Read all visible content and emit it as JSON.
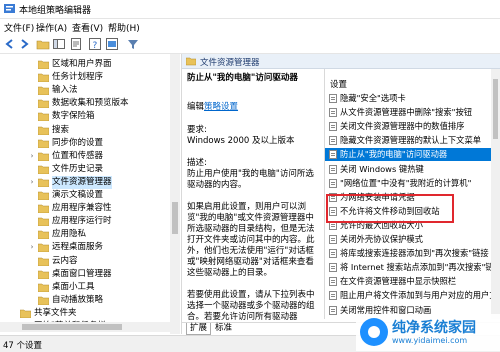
{
  "window": {
    "title": "本地组策略编辑器"
  },
  "menu": [
    "文件(F)",
    "操作(A)",
    "查看(V)",
    "帮助(H)"
  ],
  "tree": {
    "items": [
      {
        "label": "区域和用户界面",
        "indent": 1,
        "arrow": ""
      },
      {
        "label": "任务计划程序",
        "indent": 1,
        "arrow": ""
      },
      {
        "label": "输入法",
        "indent": 1,
        "arrow": ""
      },
      {
        "label": "数据收集和预览版本",
        "indent": 1,
        "arrow": ""
      },
      {
        "label": "数字保险箱",
        "indent": 1,
        "arrow": ""
      },
      {
        "label": "搜索",
        "indent": 1,
        "arrow": ""
      },
      {
        "label": "同步你的设置",
        "indent": 1,
        "arrow": ""
      },
      {
        "label": "位置和传感器",
        "indent": 1,
        "arrow": "›"
      },
      {
        "label": "文件历史记录",
        "indent": 1,
        "arrow": ""
      },
      {
        "label": "文件资源管理器",
        "indent": 1,
        "arrow": "›",
        "selected": true
      },
      {
        "label": "演示文稿设置",
        "indent": 1,
        "arrow": ""
      },
      {
        "label": "应用程序兼容性",
        "indent": 1,
        "arrow": ""
      },
      {
        "label": "应用程序运行时",
        "indent": 1,
        "arrow": ""
      },
      {
        "label": "应用隐私",
        "indent": 1,
        "arrow": ""
      },
      {
        "label": "远程桌面服务",
        "indent": 1,
        "arrow": "›"
      },
      {
        "label": "云内容",
        "indent": 1,
        "arrow": ""
      },
      {
        "label": "桌面窗口管理器",
        "indent": 1,
        "arrow": ""
      },
      {
        "label": "桌面小工具",
        "indent": 1,
        "arrow": ""
      },
      {
        "label": "自动播放策略",
        "indent": 1,
        "arrow": ""
      },
      {
        "label": "共享文件夹",
        "indent": 0,
        "arrow": ""
      },
      {
        "label": "开始\"菜单和任务栏",
        "indent": 0,
        "arrow": "›"
      }
    ]
  },
  "detail": {
    "header": "文件资源管理器",
    "policy_title": "防止从\"我的电脑\"访问驱动器",
    "edit_prefix": "编辑",
    "edit_link": "策略设置",
    "req_label": "要求:",
    "req_value": "Windows 2000 及以上版本",
    "desc_label": "描述:",
    "desc_text": "防止用户使用\"我的电脑\"访问所选驱动器的内容。",
    "desc_more": "如果启用此设置，则用户可以浏览\"我的电脑\"或文件资源管理器中所选驱动器的目录结构，但是无法打开文件夹或访问其中的内容。此外，他们也无法使用\"运行\"对话框或\"映射网络驱动器\"对话框来查看这些驱动器上的目录。",
    "desc_more2": "若要使用此设置，请从下拉列表中选择一个驱动器或多个驱动器的组合。若要允许访问所有驱动器"
  },
  "list": {
    "column": "设置",
    "items": [
      {
        "label": "隐藏\"安全\"选项卡"
      },
      {
        "label": "从文件资源管理器中删除\"搜索\"按钮"
      },
      {
        "label": "关闭文件资源管理器中的数值排序"
      },
      {
        "label": "隐藏文件资源管理器的默认上下文菜单"
      },
      {
        "label": "防止从\"我的电脑\"访问驱动器",
        "selected": true
      },
      {
        "label": "关闭 Windows 键热键"
      },
      {
        "label": "\"网络位置\"中没有\"我附近的计算机\""
      },
      {
        "label": "为网络安装申请凭据"
      },
      {
        "label": "不允许将文件移动到回收站"
      },
      {
        "label": "允许的最大回收站大小"
      },
      {
        "label": "关闭外壳协议保护模式"
      },
      {
        "label": "将库或搜索连接器添加到\"再次搜索\"链接"
      },
      {
        "label": "将 Internet 搜索站点添加到\"再次搜索\"链接"
      },
      {
        "label": "在文件资源管理器中显示快照栏"
      },
      {
        "label": "阻止用户将文件添加到与用户对应的用户文件夹"
      },
      {
        "label": "关闭常用控件和窗口动画"
      }
    ]
  },
  "tabs": [
    "扩展",
    "标准"
  ],
  "status": "47 个设置",
  "watermark": {
    "title": "纯净系统家园",
    "sub": "www.yidaimei.com"
  }
}
